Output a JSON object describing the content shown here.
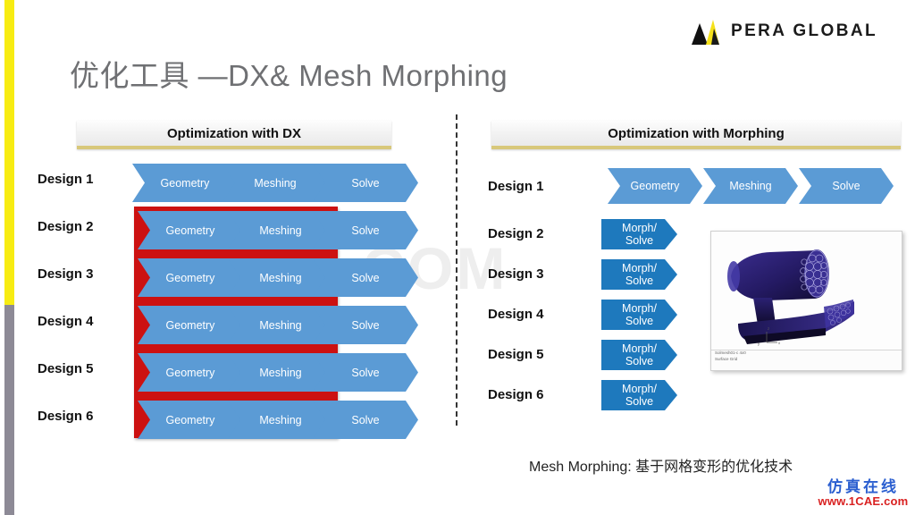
{
  "brand": {
    "logo_text": "PERA GLOBAL",
    "logo_icon": "pera-triangle-logo",
    "accent_yellow": "#f7ec13",
    "accent_gray": "#8d8a96"
  },
  "page_title": "优化工具 —DX& Mesh Morphing",
  "panels": {
    "left": {
      "header": "Optimization with DX",
      "stage_labels": [
        "Geometry",
        "Meshing",
        "Solve"
      ],
      "rows": [
        {
          "label": "Design 1",
          "highlighted": false
        },
        {
          "label": "Design 2",
          "highlighted": true
        },
        {
          "label": "Design 3",
          "highlighted": true
        },
        {
          "label": "Design 4",
          "highlighted": true
        },
        {
          "label": "Design 5",
          "highlighted": true
        },
        {
          "label": "Design 6",
          "highlighted": true
        }
      ],
      "highlight_color": "#cc1111"
    },
    "right": {
      "header": "Optimization with Morphing",
      "first_row_stages": [
        "Geometry",
        "Meshing",
        "Solve"
      ],
      "morph_label_line1": "Morph/",
      "morph_label_line2": "Solve",
      "rows": [
        {
          "label": "Design 1",
          "type": "full"
        },
        {
          "label": "Design 2",
          "type": "morph"
        },
        {
          "label": "Design 3",
          "type": "morph"
        },
        {
          "label": "Design 4",
          "type": "morph"
        },
        {
          "label": "Design 5",
          "type": "morph"
        },
        {
          "label": "Design 6",
          "type": "morph"
        }
      ],
      "caption": "Mesh Morphing: 基于网格变形的优化技术",
      "inset": {
        "name": "cfd-surface-grid-image",
        "caption_line1": "Solmesh01-c 4x0",
        "caption_line2": "Surface Grid"
      }
    }
  },
  "colors": {
    "chevron_light": "#5b9bd5",
    "chevron_dark": "#1e79bd",
    "header_underline": "#d8c87a"
  },
  "watermarks": {
    "center": "1CAE.COM",
    "brand_cn": "仿真在线",
    "brand_url": "www.1CAE.com"
  }
}
